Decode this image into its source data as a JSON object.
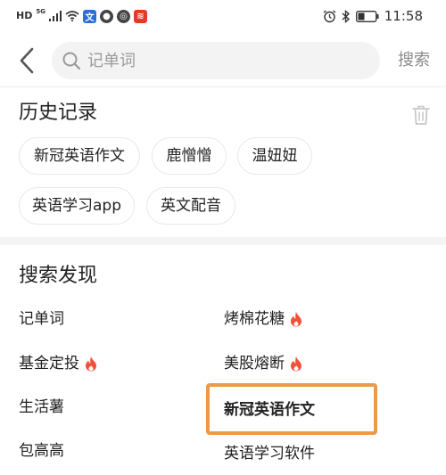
{
  "status_bar": {
    "hd": "HD",
    "network": "5G",
    "time": "11:58",
    "icons": [
      "signal-icon",
      "wifi-icon",
      "app-notification-icon",
      "app-notification-icon",
      "app-notification-icon",
      "app-notification-icon",
      "alarm-icon",
      "bluetooth-icon",
      "battery-icon"
    ]
  },
  "search": {
    "placeholder": "记单词",
    "value": "",
    "button_label": "搜索"
  },
  "history": {
    "title": "历史记录",
    "items": [
      "新冠英语作文",
      "鹿憎憎",
      "温妞妞",
      "英语学习app",
      "英文配音"
    ]
  },
  "discover": {
    "title": "搜索发现",
    "items": [
      {
        "label": "记单词",
        "hot": false
      },
      {
        "label": "烤棉花糖",
        "hot": true
      },
      {
        "label": "基金定投",
        "hot": true
      },
      {
        "label": "美股熔断",
        "hot": true
      },
      {
        "label": "生活薯",
        "hot": false
      },
      {
        "label": "新冠英语作文",
        "hot": false
      },
      {
        "label": "包高高",
        "hot": false
      },
      {
        "label": "英语学习软件",
        "hot": false
      }
    ]
  },
  "colors": {
    "hot": "#f05138",
    "highlight": "#ec9a4a",
    "search_bg": "#f3f3f3",
    "muted": "#8a8a8a"
  }
}
